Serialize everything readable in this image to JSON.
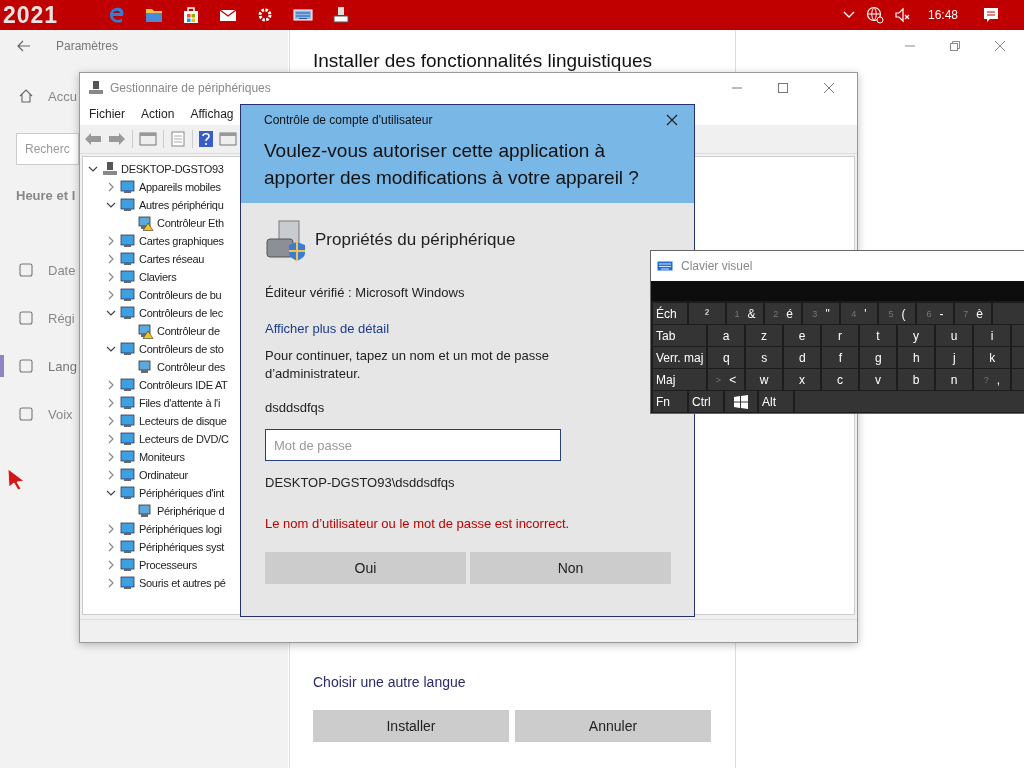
{
  "taskbar": {
    "logo": "2021",
    "clock": "16:48"
  },
  "settings": {
    "title": "Paramètres",
    "home": "Accu",
    "search_placeholder": "Recherc",
    "section": "Heure et l",
    "nav": [
      {
        "label": "Date",
        "selected": false
      },
      {
        "label": "Régi",
        "selected": false
      },
      {
        "label": "Lang",
        "selected": true
      },
      {
        "label": "Voix",
        "selected": false
      }
    ]
  },
  "language_panel": {
    "title": "Installer des fonctionnalités linguistiques",
    "link": "Choisir une autre langue",
    "buttons": [
      "Installer",
      "Annuler"
    ]
  },
  "device_manager": {
    "title": "Gestionnaire de périphériques",
    "menu": [
      "Fichier",
      "Action",
      "Affichag"
    ],
    "tree": {
      "label": "DESKTOP-DGSTO93",
      "expanded": true,
      "children": [
        {
          "label": "Appareils mobiles",
          "expanded": false
        },
        {
          "label": "Autres périphériqu",
          "expanded": true,
          "children": [
            {
              "label": "Contrôleur Eth",
              "warning": true
            }
          ]
        },
        {
          "label": "Cartes graphiques",
          "expanded": false
        },
        {
          "label": "Cartes réseau",
          "expanded": false
        },
        {
          "label": "Claviers",
          "expanded": false
        },
        {
          "label": "Contrôleurs de bu",
          "expanded": false
        },
        {
          "label": "Contrôleurs de lec",
          "expanded": true,
          "children": [
            {
              "label": "Contrôleur de",
              "warning": true
            }
          ]
        },
        {
          "label": "Contrôleurs de sto",
          "expanded": true,
          "children": [
            {
              "label": "Contrôleur des",
              "warning": false
            }
          ]
        },
        {
          "label": "Contrôleurs IDE AT",
          "expanded": false
        },
        {
          "label": "Files d'attente à l'i",
          "expanded": false
        },
        {
          "label": "Lecteurs de disque",
          "expanded": false
        },
        {
          "label": "Lecteurs de DVD/C",
          "expanded": false
        },
        {
          "label": "Moniteurs",
          "expanded": false
        },
        {
          "label": "Ordinateur",
          "expanded": false
        },
        {
          "label": "Périphériques d'int",
          "expanded": true,
          "children": [
            {
              "label": "Périphérique d",
              "warning": false
            }
          ]
        },
        {
          "label": "Périphériques logi",
          "expanded": false
        },
        {
          "label": "Périphériques syst",
          "expanded": false
        },
        {
          "label": "Processeurs",
          "expanded": false
        },
        {
          "label": "Souris et autres pé",
          "expanded": false
        }
      ]
    }
  },
  "uac": {
    "header": "Contrôle de compte d'utilisateur",
    "question": "Voulez-vous autoriser cette application à apporter des modifications à votre appareil ?",
    "app_name": "Propriétés du périphérique",
    "publisher": "Éditeur vérifié : Microsoft Windows",
    "details_link": "Afficher plus de détail",
    "instruction": "Pour continuer, tapez un nom et un mot de passe d’administrateur.",
    "username": "dsddsdfqs",
    "password_placeholder": "Mot de passe",
    "account": "DESKTOP-DGSTO93\\dsddsdfqs",
    "error": "Le nom d’utilisateur ou le mot de passe est incorrect.",
    "buttons": [
      "Oui",
      "Non"
    ]
  },
  "keyboard": {
    "title": "Clavier visuel",
    "rows": [
      [
        {
          "kind": "mod",
          "main": "Éch"
        },
        {
          "kind": "char",
          "main": "²"
        },
        {
          "kind": "char",
          "shift": "1",
          "main": "&"
        },
        {
          "kind": "char",
          "shift": "2",
          "main": "é"
        },
        {
          "kind": "char",
          "shift": "3",
          "main": "\""
        },
        {
          "kind": "char",
          "shift": "4",
          "main": "'"
        },
        {
          "kind": "char",
          "shift": "5",
          "main": "("
        },
        {
          "kind": "char",
          "shift": "6",
          "main": "-"
        },
        {
          "kind": "char",
          "shift": "7",
          "main": "è"
        }
      ],
      [
        {
          "kind": "mod",
          "main": "Tab"
        },
        {
          "kind": "char",
          "main": "a"
        },
        {
          "kind": "char",
          "main": "z"
        },
        {
          "kind": "char",
          "main": "e"
        },
        {
          "kind": "char",
          "main": "r"
        },
        {
          "kind": "char",
          "main": "t"
        },
        {
          "kind": "char",
          "main": "y"
        },
        {
          "kind": "char",
          "main": "u"
        },
        {
          "kind": "char",
          "main": "i"
        }
      ],
      [
        {
          "kind": "mod",
          "main": "Verr. maj"
        },
        {
          "kind": "char",
          "main": "q"
        },
        {
          "kind": "char",
          "main": "s"
        },
        {
          "kind": "char",
          "main": "d"
        },
        {
          "kind": "char",
          "main": "f"
        },
        {
          "kind": "char",
          "main": "g"
        },
        {
          "kind": "char",
          "main": "h"
        },
        {
          "kind": "char",
          "main": "j"
        },
        {
          "kind": "char",
          "main": "k"
        }
      ],
      [
        {
          "kind": "mod",
          "main": "Maj"
        },
        {
          "kind": "char",
          "shift": ">",
          "main": "<"
        },
        {
          "kind": "char",
          "main": "w"
        },
        {
          "kind": "char",
          "main": "x"
        },
        {
          "kind": "char",
          "main": "c"
        },
        {
          "kind": "char",
          "main": "v"
        },
        {
          "kind": "char",
          "main": "b"
        },
        {
          "kind": "char",
          "main": "n"
        },
        {
          "kind": "char",
          "shift": "?",
          "main": ","
        }
      ],
      [
        {
          "kind": "mod",
          "main": "Fn"
        },
        {
          "kind": "mod",
          "main": "Ctrl"
        },
        {
          "kind": "logo"
        },
        {
          "kind": "mod",
          "main": "Alt"
        },
        {
          "kind": "space"
        }
      ]
    ]
  }
}
